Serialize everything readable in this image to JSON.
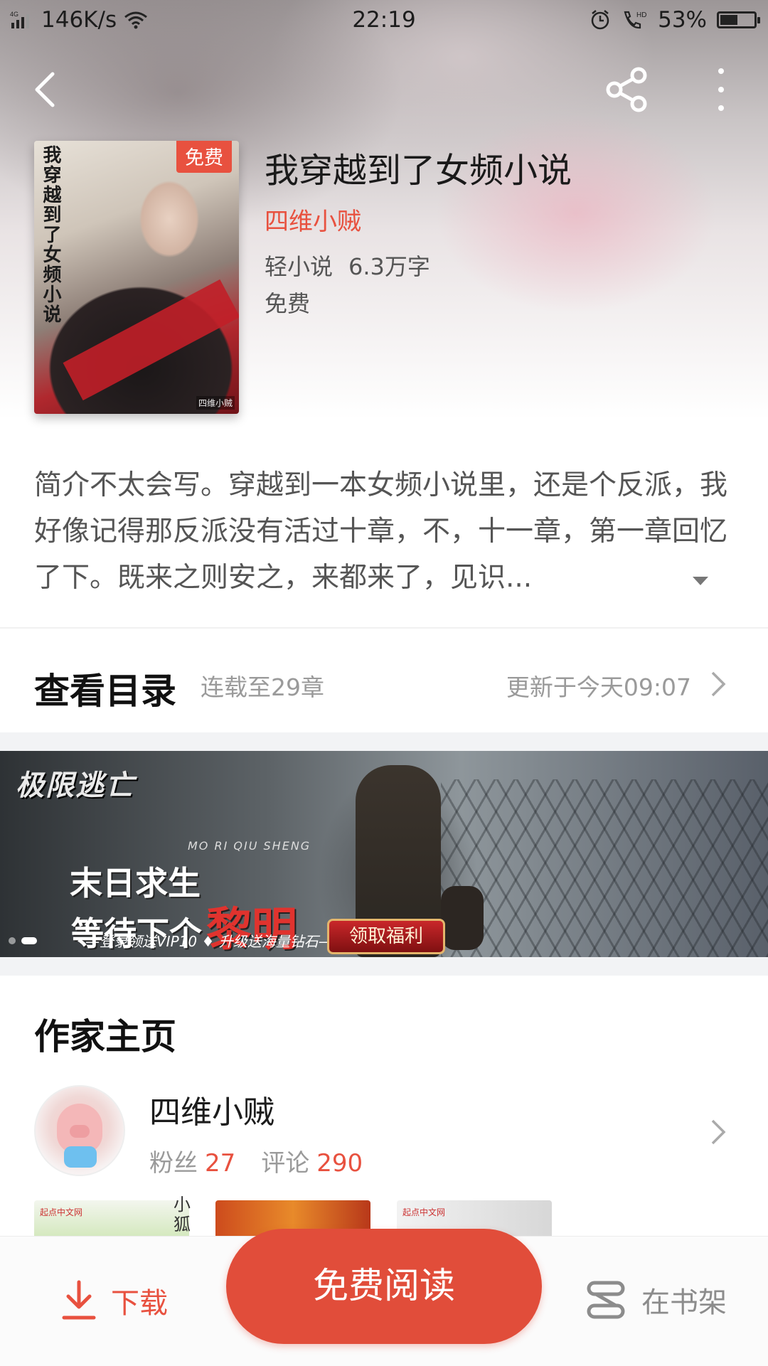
{
  "status_bar": {
    "network": "4G",
    "speed": "146K/s",
    "time": "22:19",
    "battery": "53%",
    "battery_level": 0.53
  },
  "book": {
    "title": "我穿越到了女频小说",
    "author": "四维小贼",
    "category": "轻小说",
    "word_count": "6.3万字",
    "price": "免费",
    "cover_title": "我穿越到了女频小说",
    "cover_badge": "免费",
    "cover_author": "四维小贼",
    "intro": "简介不太会写。穿越到一本女频小说里，还是个反派，我好像记得那反派没有活过十章，不，十一章，第一章回忆了下。既来之则安之，来都来了，见识..."
  },
  "toc": {
    "title": "查看目录",
    "status": "连载至29章",
    "updated": "更新于今天09:07"
  },
  "banner": {
    "logo": "极限逃亡",
    "line1": "末日求生",
    "line1_highlight": "黎明",
    "line2": "等待下个",
    "pinyin": "MO RI QIU SHENG",
    "sub": "—登录领送VIP10 ♦ 升级送海量钻石—",
    "button": "领取福利",
    "slide_count": 2,
    "active_slide": 2
  },
  "author_section": {
    "title": "作家主页",
    "name": "四维小贼",
    "fans_label": "粉丝",
    "fans": "27",
    "comments_label": "评论",
    "comments": "290",
    "thumb1_label": "起点中文网",
    "thumb1_side": "小狐",
    "thumb3_label": "起点中文网"
  },
  "bottom_bar": {
    "download_label": "下载",
    "read_label": "免费阅读",
    "shelf_label": "在书架"
  }
}
